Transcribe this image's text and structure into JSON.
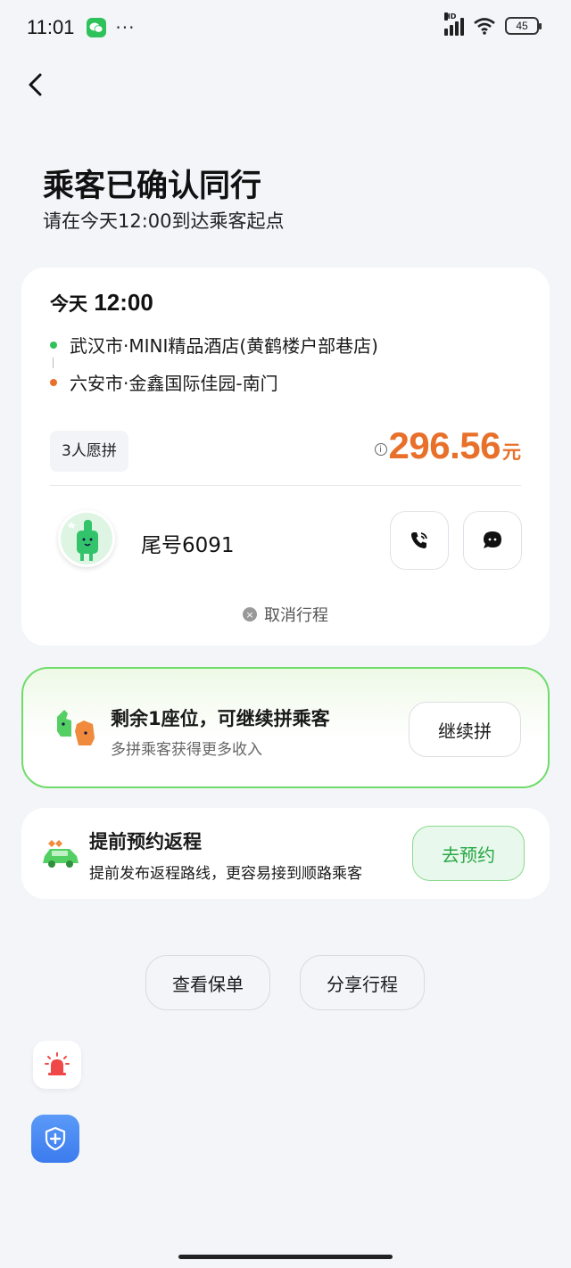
{
  "status_bar": {
    "time": "11:01",
    "dots": "···",
    "hd": "HD",
    "battery": "45"
  },
  "page": {
    "title": "乘客已确认同行",
    "subtitle": "请在今天12:00到达乘客起点"
  },
  "trip": {
    "day": "今天",
    "time": "12:00",
    "origin": "武汉市·MINI精品酒店(黄鹤楼户部巷店)",
    "destination": "六安市·金鑫国际佳园-南门",
    "pool_badge": "3人愿拼",
    "price": "296.56",
    "currency": "元",
    "origin_color": "#2fc25b",
    "destination_color": "#e8702a"
  },
  "passenger": {
    "name": "尾号6091"
  },
  "actions": {
    "cancel": "取消行程"
  },
  "pool_promo": {
    "title": "剩余1座位，可继续拼乘客",
    "desc": "多拼乘客获得更多收入",
    "button": "继续拼"
  },
  "return_promo": {
    "title": "提前预约返程",
    "desc": "提前发布返程路线，更容易接到顺路乘客",
    "button": "去预约"
  },
  "bottom_buttons": {
    "policy": "查看保单",
    "share": "分享行程"
  },
  "colors": {
    "accent_green": "#2fc25b",
    "price_orange": "#e8702a",
    "shield_blue": "#3b7bed",
    "alarm_red": "#f04848"
  }
}
